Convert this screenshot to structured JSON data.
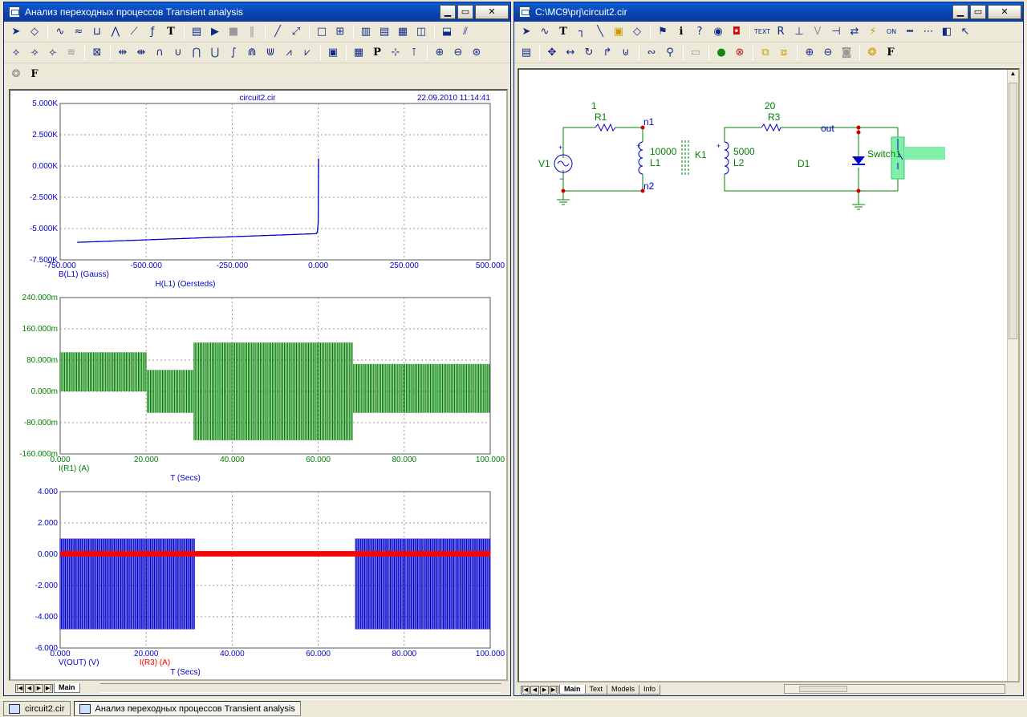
{
  "left_window": {
    "title": "Анализ переходных процессов Transient analysis",
    "plot_header": {
      "file": "circuit2.cir",
      "datetime": "22.09.2010 11:14:41"
    },
    "plot1": {
      "y_ticks": [
        "5.000K",
        "2.500K",
        "0.000K",
        "-2.500K",
        "-5.000K",
        "-7.500K"
      ],
      "x_ticks": [
        "-750.000",
        "-500.000",
        "-250.000",
        "0.000",
        "250.000",
        "500.000"
      ],
      "y_label": "B(L1) (Gauss)",
      "x_label": "H(L1) (Oersteds)"
    },
    "plot2": {
      "y_ticks": [
        "240.000m",
        "160.000m",
        "80.000m",
        "0.000m",
        "-80.000m",
        "-160.000m"
      ],
      "x_ticks": [
        "0.000",
        "20.000",
        "40.000",
        "60.000",
        "80.000",
        "100.000"
      ],
      "y_label": "I(R1) (A)",
      "x_label": "T (Secs)"
    },
    "plot3": {
      "y_ticks": [
        "4.000",
        "2.000",
        "0.000",
        "-2.000",
        "-4.000",
        "-6.000"
      ],
      "x_ticks": [
        "0.000",
        "20.000",
        "40.000",
        "60.000",
        "80.000",
        "100.000"
      ],
      "y_label": "V(OUT) (V)",
      "y_label2": "I(R3) (A)",
      "x_label": "T (Secs)"
    },
    "tabs": [
      "Main"
    ]
  },
  "right_window": {
    "title": "C:\\MC9\\prj\\circuit2.cir",
    "schematic": {
      "r1_value": "1",
      "r1_name": "R1",
      "n1": "n1",
      "n2": "n2",
      "l1_value": "10000",
      "l1_name": "L1",
      "k1": "K1",
      "v1": "V1",
      "r3_value": "20",
      "r3_name": "R3",
      "out": "out",
      "l2_value": "5000",
      "l2_name": "L2",
      "d1": "D1",
      "switch": "Switch1"
    },
    "tabs": [
      "Main",
      "Text",
      "Models",
      "Info"
    ]
  },
  "taskbar": {
    "items": [
      "circuit2.cir",
      "Анализ переходных процессов Transient analysis"
    ]
  },
  "colors": {
    "plot_blue": "#0000cc",
    "plot_green": "#008000",
    "plot_red": "#ff0000",
    "wire": "#008000",
    "node_dot": "#cc0000"
  }
}
